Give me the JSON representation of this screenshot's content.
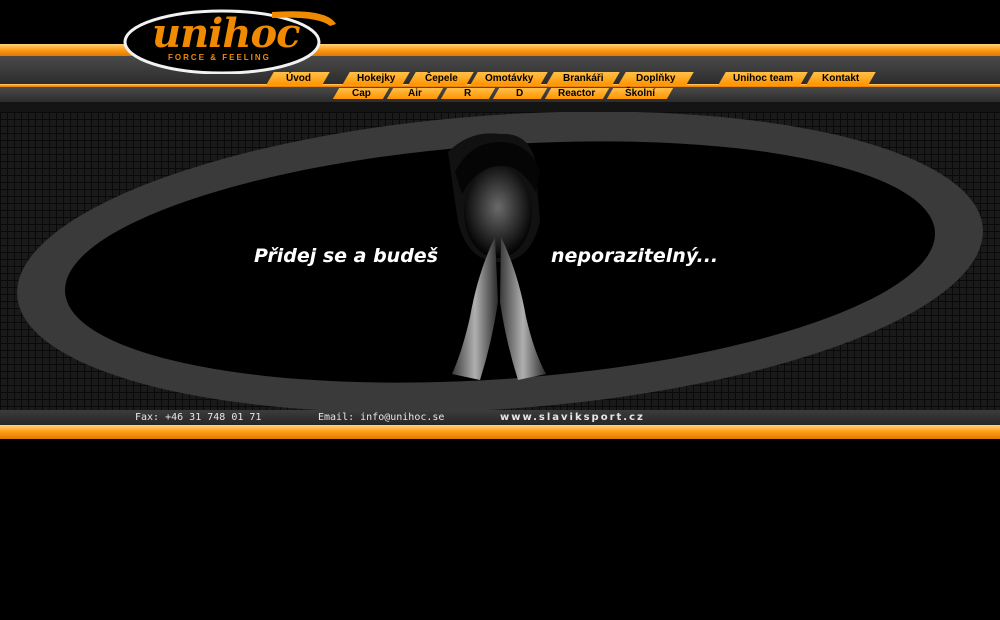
{
  "brand": {
    "logo_text": "unihoc",
    "tagline": "FORCE & FEELING",
    "accent_color": "#ff9400"
  },
  "nav": {
    "main": [
      {
        "label": "Úvod"
      },
      {
        "label": "Hokejky"
      },
      {
        "label": "Čepele"
      },
      {
        "label": "Omotávky"
      },
      {
        "label": "Brankáři"
      },
      {
        "label": "Doplňky"
      },
      {
        "label": "Unihoc team"
      },
      {
        "label": "Kontakt"
      }
    ],
    "sub": [
      {
        "label": "Cap"
      },
      {
        "label": "Air"
      },
      {
        "label": "R"
      },
      {
        "label": "D"
      },
      {
        "label": "Reactor"
      },
      {
        "label": "Školní"
      }
    ]
  },
  "banner": {
    "headline_left": "Přidej se a budeš",
    "headline_right": "neporazitelný..."
  },
  "footer": {
    "fax": "Fax: +46 31 748 01 71",
    "email": "Email: info@unihoc.se",
    "website": "www.slaviksport.cz"
  }
}
